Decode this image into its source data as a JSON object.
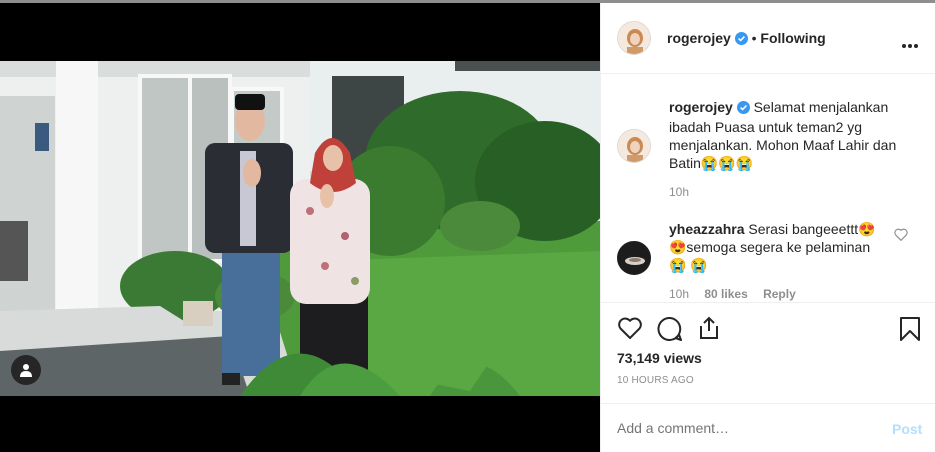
{
  "post": {
    "username": "rogerojey",
    "following_label": "Following",
    "separator": "•",
    "more_icon": "more-horizontal-icon",
    "caption": "Selamat menjalankan ibadah Puasa untuk teman2 yg menjalankan. Mohon Maaf Lahir dan Batin😭😭😭",
    "caption_time": "10h"
  },
  "comment": {
    "username": "yheazzahra",
    "text": "Serasi bangeeettt😍 😍semoga segera ke pelaminan😭 😭",
    "time": "10h",
    "likes": "80 likes",
    "reply_label": "Reply"
  },
  "stats": {
    "views": "73,149 views",
    "posted": "10 HOURS AGO"
  },
  "add_comment": {
    "placeholder": "Add a comment…",
    "post_label": "Post"
  },
  "colors": {
    "verified": "#3897f0",
    "link": "#b2dffc",
    "muted": "#8e8e8e"
  }
}
